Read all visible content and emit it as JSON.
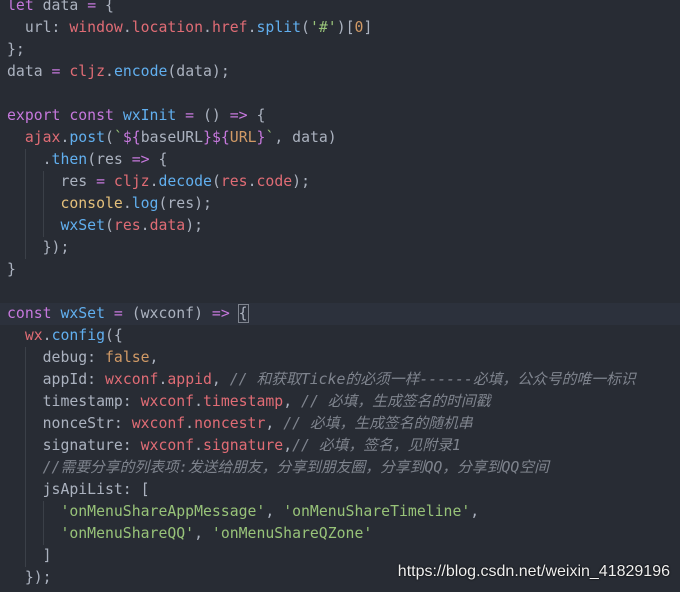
{
  "theme": {
    "background": "#282c34",
    "current_line": "#2c313c",
    "indent_guide": "#3b4048",
    "bracket_match": "#7f848e",
    "watermark_color": "#f0f0f0",
    "syntax": {
      "plain": "#abb2bf",
      "property": "#abb2bf",
      "keyword": "#c678dd",
      "operator": "#c678dd",
      "template": "#c678dd",
      "function": "#61afef",
      "variable": "#e06c75",
      "string": "#98c379",
      "number": "#d19a66",
      "constant": "#d19a66",
      "support": "#e5c07b",
      "comment": "#7f848e",
      "match": "#abb2bf"
    }
  },
  "editor": {
    "lines": [
      {
        "tokens": [
          {
            "keyword": "let"
          },
          {
            "plain": " data "
          },
          {
            "operator": "="
          },
          {
            "plain": " {"
          }
        ]
      },
      {
        "tokens": [
          {
            "property": "  url: "
          },
          {
            "variable": "window"
          },
          {
            "plain": "."
          },
          {
            "variable": "location"
          },
          {
            "plain": "."
          },
          {
            "variable": "href"
          },
          {
            "plain": "."
          },
          {
            "function": "split"
          },
          {
            "plain": "("
          },
          {
            "string": "'#'"
          },
          {
            "plain": ")["
          },
          {
            "number": "0"
          },
          {
            "plain": "]"
          }
        ]
      },
      {
        "tokens": [
          {
            "plain": "};"
          }
        ]
      },
      {
        "tokens": [
          {
            "plain": "data "
          },
          {
            "operator": "= "
          },
          {
            "variable": "cljz"
          },
          {
            "plain": "."
          },
          {
            "function": "encode"
          },
          {
            "plain": "(data);"
          }
        ]
      },
      {
        "tokens": []
      },
      {
        "tokens": [
          {
            "keyword": "export const "
          },
          {
            "function": "wxInit"
          },
          {
            "operator": " = "
          },
          {
            "plain": "() "
          },
          {
            "operator": "=>"
          },
          {
            "plain": " {"
          }
        ]
      },
      {
        "tokens": [
          {
            "variable": "  ajax"
          },
          {
            "plain": "."
          },
          {
            "function": "post"
          },
          {
            "plain": "("
          },
          {
            "string": "`"
          },
          {
            "template": "${"
          },
          {
            "plain": "baseURL"
          },
          {
            "template": "}${"
          },
          {
            "constant": "URL"
          },
          {
            "template": "}"
          },
          {
            "string": "`"
          },
          {
            "plain": ", data)"
          }
        ]
      },
      {
        "tokens": [
          {
            "plain": "    ."
          },
          {
            "function": "then"
          },
          {
            "plain": "(res "
          },
          {
            "operator": "=>"
          },
          {
            "plain": " {"
          }
        ]
      },
      {
        "tokens": [
          {
            "plain": "      res "
          },
          {
            "operator": "= "
          },
          {
            "variable": "cljz"
          },
          {
            "plain": "."
          },
          {
            "function": "decode"
          },
          {
            "plain": "("
          },
          {
            "variable": "res"
          },
          {
            "plain": "."
          },
          {
            "variable": "code"
          },
          {
            "plain": ");"
          }
        ]
      },
      {
        "tokens": [
          {
            "support": "      console"
          },
          {
            "plain": "."
          },
          {
            "function": "log"
          },
          {
            "plain": "(res);"
          }
        ]
      },
      {
        "tokens": [
          {
            "function": "      wxSet"
          },
          {
            "plain": "("
          },
          {
            "variable": "res"
          },
          {
            "plain": "."
          },
          {
            "variable": "data"
          },
          {
            "plain": ");"
          }
        ]
      },
      {
        "tokens": [
          {
            "plain": "    });"
          }
        ]
      },
      {
        "tokens": [
          {
            "plain": "}"
          }
        ]
      },
      {
        "tokens": []
      },
      {
        "current": true,
        "tokens": [
          {
            "keyword": "const "
          },
          {
            "function": "wxSet"
          },
          {
            "operator": " = "
          },
          {
            "plain": "(wxconf) "
          },
          {
            "operator": "=> "
          },
          {
            "match": "{"
          }
        ]
      },
      {
        "tokens": [
          {
            "variable": "  wx"
          },
          {
            "plain": "."
          },
          {
            "function": "config"
          },
          {
            "plain": "({"
          }
        ]
      },
      {
        "tokens": [
          {
            "property": "    debug: "
          },
          {
            "number": "false"
          },
          {
            "plain": ","
          }
        ]
      },
      {
        "tokens": [
          {
            "property": "    appId: "
          },
          {
            "variable": "wxconf"
          },
          {
            "plain": "."
          },
          {
            "variable": "appid"
          },
          {
            "plain": ", "
          },
          {
            "comment": "// 和获取Ticke的必须一样------必填，公众号的唯一标识"
          }
        ]
      },
      {
        "tokens": [
          {
            "property": "    timestamp: "
          },
          {
            "variable": "wxconf"
          },
          {
            "plain": "."
          },
          {
            "variable": "timestamp"
          },
          {
            "plain": ", "
          },
          {
            "comment": "// 必填，生成签名的时间戳"
          }
        ]
      },
      {
        "tokens": [
          {
            "property": "    nonceStr: "
          },
          {
            "variable": "wxconf"
          },
          {
            "plain": "."
          },
          {
            "variable": "noncestr"
          },
          {
            "plain": ", "
          },
          {
            "comment": "// 必填，生成签名的随机串"
          }
        ]
      },
      {
        "tokens": [
          {
            "property": "    signature: "
          },
          {
            "variable": "wxconf"
          },
          {
            "plain": "."
          },
          {
            "variable": "signature"
          },
          {
            "plain": ","
          },
          {
            "comment": "// 必填，签名，见附录1"
          }
        ]
      },
      {
        "tokens": [
          {
            "comment": "    //需要分享的列表项:发送给朋友，分享到朋友圈，分享到QQ，分享到QQ空间"
          }
        ]
      },
      {
        "tokens": [
          {
            "property": "    jsApiList: "
          },
          {
            "plain": "["
          }
        ]
      },
      {
        "tokens": [
          {
            "string": "      'onMenuShareAppMessage'"
          },
          {
            "plain": ", "
          },
          {
            "string": "'onMenuShareTimeline'"
          },
          {
            "plain": ","
          }
        ]
      },
      {
        "tokens": [
          {
            "string": "      'onMenuShareQQ'"
          },
          {
            "plain": ", "
          },
          {
            "string": "'onMenuShareQZone'"
          }
        ]
      },
      {
        "tokens": [
          {
            "plain": "    ]"
          }
        ]
      },
      {
        "tokens": [
          {
            "plain": "  });"
          }
        ]
      }
    ]
  },
  "watermark": "https://blog.csdn.net/weixin_41829196"
}
